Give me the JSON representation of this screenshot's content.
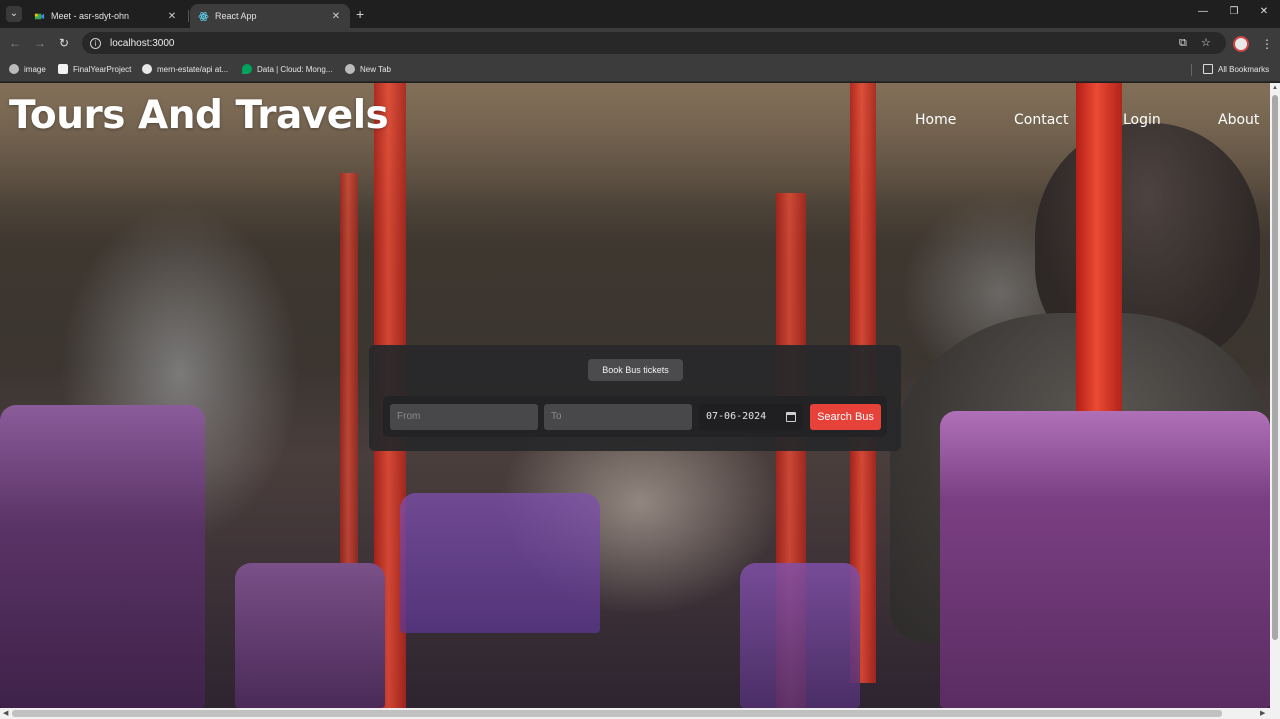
{
  "browser": {
    "tabs": [
      {
        "title": "Meet - asr-sdyt-ohn",
        "active": false,
        "icon": "google-meet-icon"
      },
      {
        "title": "React App",
        "active": true,
        "icon": "react-icon"
      }
    ],
    "url": "localhost:3000",
    "bookmarks": [
      {
        "label": "image",
        "icon": "globe-icon"
      },
      {
        "label": "FinalYearProject",
        "icon": "project-icon"
      },
      {
        "label": "mern-estate/api at...",
        "icon": "github-icon"
      },
      {
        "label": "Data | Cloud: Mong...",
        "icon": "mongodb-leaf-icon"
      },
      {
        "label": "New Tab",
        "icon": "globe-icon"
      }
    ],
    "all_bookmarks_label": "All Bookmarks"
  },
  "site": {
    "title": "Tours And Travels",
    "nav": [
      "Home",
      "Contact",
      "Login",
      "About"
    ]
  },
  "booking": {
    "header_button": "Book Bus tickets",
    "from_placeholder": "From",
    "to_placeholder": "To",
    "date_value": "07-06-2024",
    "search_button": "Search Bus"
  },
  "colors": {
    "accent": "#e7423a",
    "card_bg": "#28282a"
  }
}
